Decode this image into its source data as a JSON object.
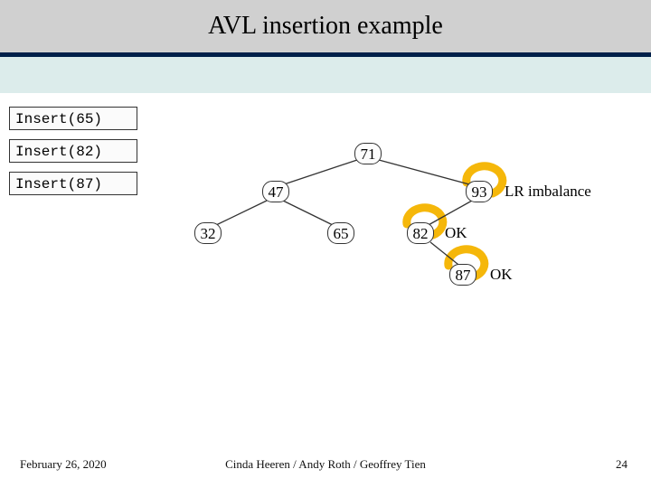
{
  "title": "AVL insertion example",
  "operations": [
    {
      "label": "Insert(65)"
    },
    {
      "label": "Insert(82)"
    },
    {
      "label": "Insert(87)"
    }
  ],
  "tree": {
    "root": "71",
    "left1": "47",
    "right1": "93",
    "left2a": "32",
    "left2b": "65",
    "leftOf93": "82",
    "leftOf82": "87"
  },
  "annotations": {
    "n93": "LR imbalance",
    "n82": "OK",
    "n87": "OK"
  },
  "footer": {
    "date": "February 26, 2020",
    "credits": "Cinda Heeren / Andy Roth / Geoffrey Tien",
    "page": "24"
  }
}
